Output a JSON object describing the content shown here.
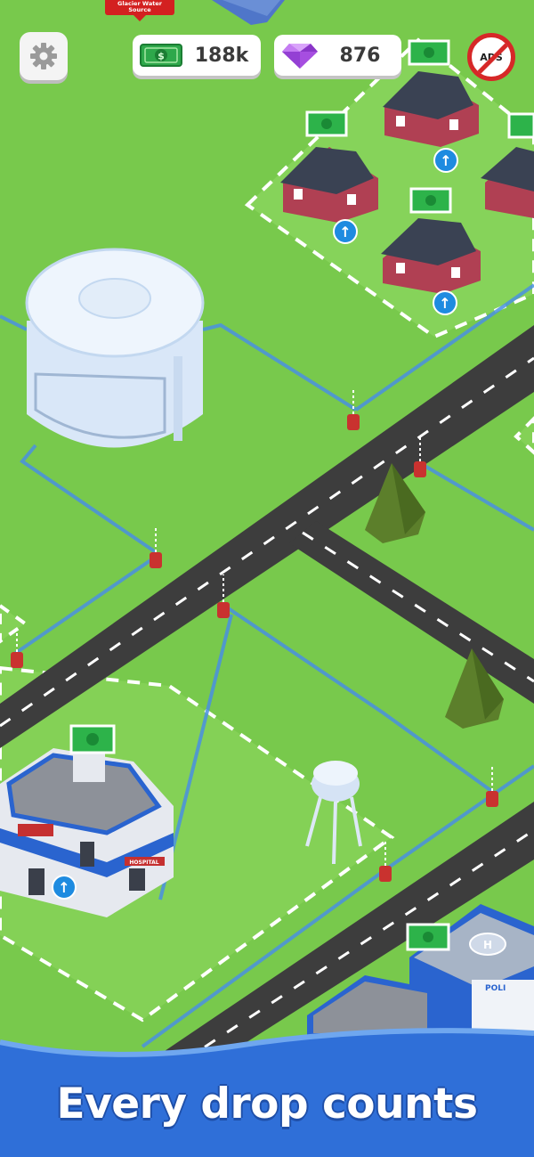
{
  "hud": {
    "cash": "188k",
    "gems": "876",
    "no_ads_label": "ADS",
    "settings_icon": "gear-icon",
    "cash_icon": "cash-icon",
    "gem_icon": "gem-icon"
  },
  "map": {
    "location_tag_line1": "Glacier Water",
    "location_tag_line2": "Source",
    "hospital_sign": "HOSPITAL",
    "police_sign": "POLI"
  },
  "banner": {
    "tagline": "Every drop counts"
  },
  "colors": {
    "grass": "#78c94c",
    "road": "#3d3d3d",
    "water_pipe": "#4a90e2",
    "banner_blue": "#2f6fd8",
    "accent_red": "#d62828"
  }
}
